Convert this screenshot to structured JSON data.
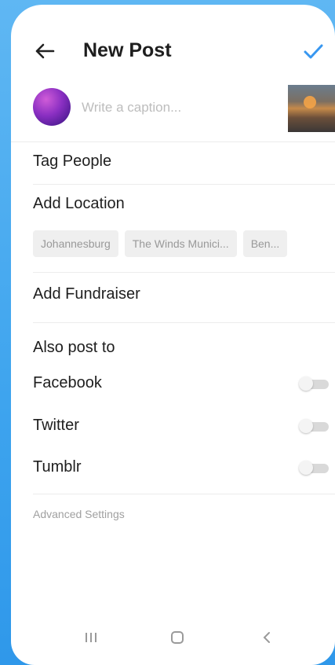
{
  "header": {
    "title": "New Post",
    "back_icon": "arrow-left-icon",
    "confirm_icon": "checkmark-icon",
    "accent": "#3897f0"
  },
  "caption": {
    "placeholder": "Write a caption..."
  },
  "menu": {
    "tag_people": "Tag People",
    "add_location": "Add Location",
    "location_suggestions": [
      "Johannesburg",
      "The Winds Munici...",
      "Ben..."
    ],
    "add_fundraiser": "Add Fundraiser"
  },
  "share": {
    "heading": "Also post to",
    "targets": [
      {
        "label": "Facebook",
        "enabled": false
      },
      {
        "label": "Twitter",
        "enabled": false
      },
      {
        "label": "Tumblr",
        "enabled": false
      }
    ]
  },
  "advanced_settings": "Advanced Settings",
  "navbar": {
    "icons": [
      "recent-apps-icon",
      "home-icon",
      "back-nav-icon"
    ]
  }
}
